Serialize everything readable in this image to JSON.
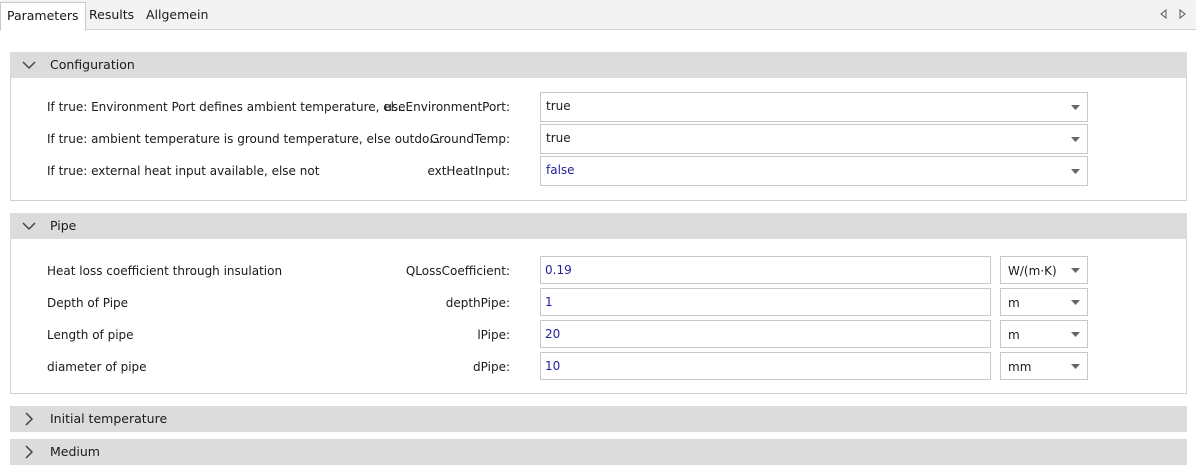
{
  "tabs": [
    {
      "label": "Parameters"
    },
    {
      "label": "Results"
    },
    {
      "label": "Allgemein"
    }
  ],
  "sections": {
    "configuration": {
      "title": "Configuration",
      "rows": [
        {
          "description": "If true: Environment Port defines ambient temperature, el...",
          "name": "useEnvironmentPort:",
          "value": "true"
        },
        {
          "description": "If true: ambient temperature is ground temperature, else outdo...",
          "name": "GroundTemp:",
          "value": "true"
        },
        {
          "description": "If true: external heat input available, else not",
          "name": "extHeatInput:",
          "value": "false"
        }
      ]
    },
    "pipe": {
      "title": "Pipe",
      "rows": [
        {
          "description": "Heat loss coefficient through insulation",
          "name": "QLossCoefficient:",
          "value": "0.19",
          "unit": "W/(m·K)"
        },
        {
          "description": "Depth of Pipe",
          "name": "depthPipe:",
          "value": "1",
          "unit": "m"
        },
        {
          "description": "Length of pipe",
          "name": "lPipe:",
          "value": "20",
          "unit": "m"
        },
        {
          "description": "diameter of pipe",
          "name": "dPipe:",
          "value": "10",
          "unit": "mm"
        }
      ]
    },
    "initial_temperature": {
      "title": "Initial temperature"
    },
    "medium": {
      "title": "Medium"
    }
  },
  "colors": {
    "header_bg": "#dcdcdc",
    "value_blue": "#1f1fa0",
    "border": "#c8c8c8"
  }
}
